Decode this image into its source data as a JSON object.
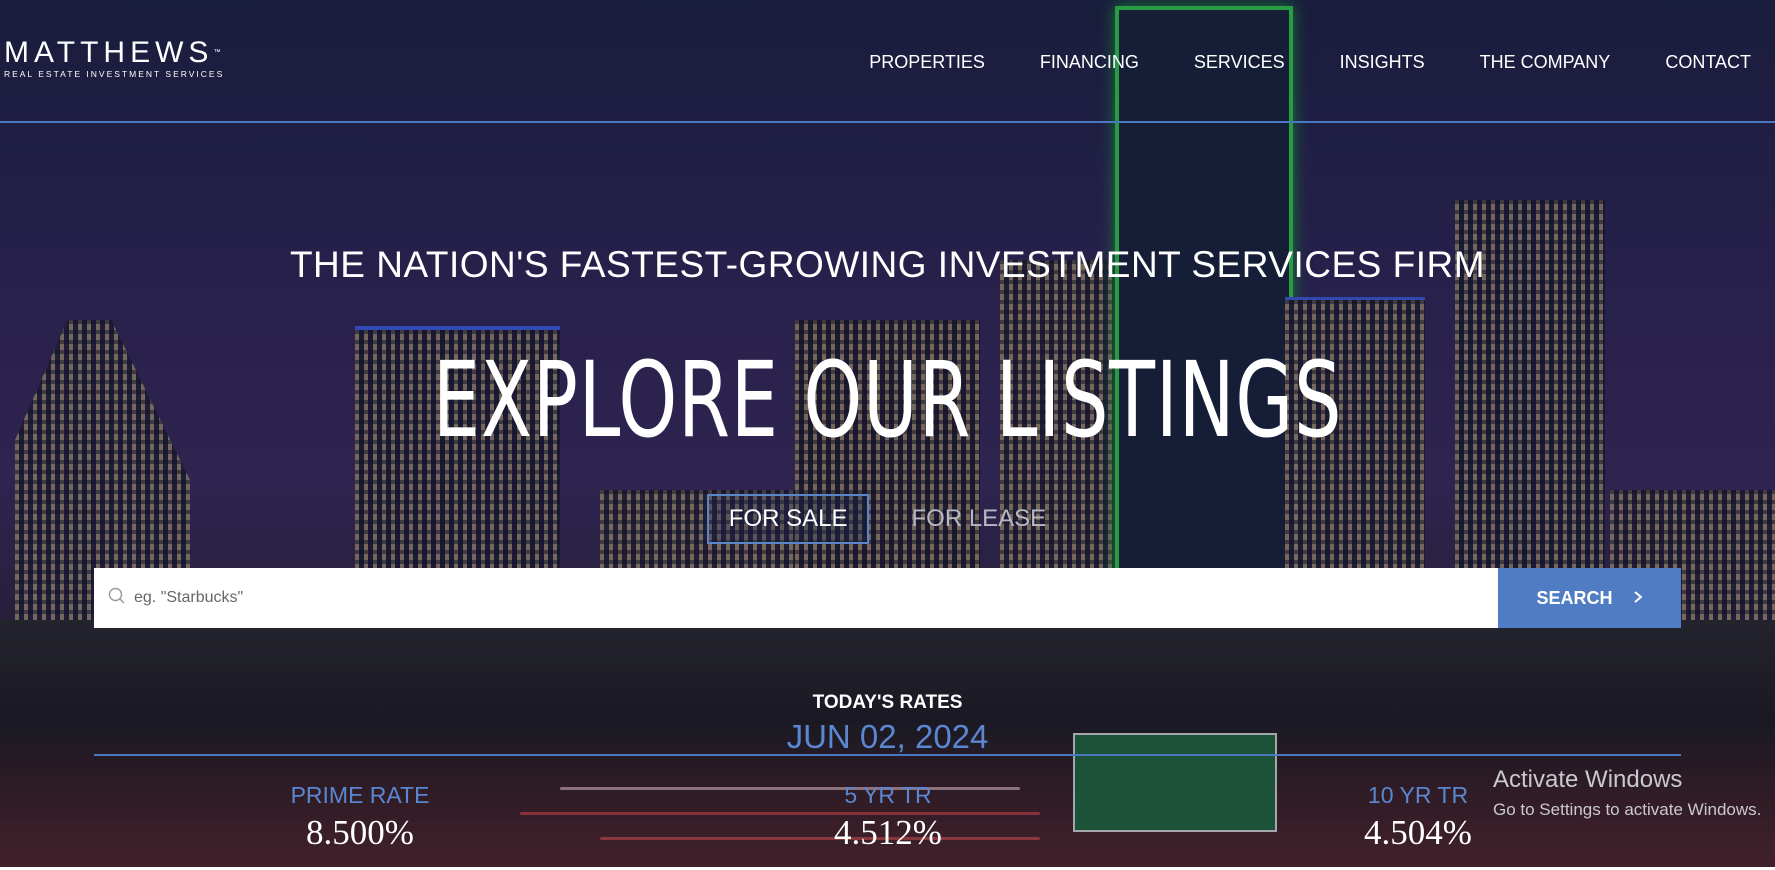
{
  "brand": {
    "name": "MATTHEWS",
    "tm": "™",
    "subtitle": "REAL ESTATE INVESTMENT SERVICES"
  },
  "nav": {
    "items": [
      "PROPERTIES",
      "FINANCING",
      "SERVICES",
      "INSIGHTS",
      "THE COMPANY",
      "CONTACT"
    ]
  },
  "hero": {
    "tagline": "THE NATION'S FASTEST-GROWING INVESTMENT SERVICES FIRM",
    "headline": "EXPLORE OUR LISTINGS"
  },
  "tabs": {
    "for_sale": "FOR SALE",
    "for_lease": "FOR LEASE",
    "active": "FOR SALE"
  },
  "search": {
    "placeholder": "eg. \"Starbucks\"",
    "value": "",
    "button_label": "SEARCH",
    "icon": "search-icon"
  },
  "rates": {
    "title": "TODAY'S RATES",
    "date": "JUN 02, 2024",
    "items": [
      {
        "label": "PRIME RATE",
        "value": "8.500%"
      },
      {
        "label": "5 YR TR",
        "value": "4.512%"
      },
      {
        "label": "10 YR TR",
        "value": "4.504%"
      }
    ]
  },
  "watermark": {
    "title": "Activate Windows",
    "subtitle": "Go to Settings to activate Windows."
  },
  "colors": {
    "accent": "#4f7cc2",
    "rate_label": "#5b86d0",
    "divider": "#4a78c0"
  }
}
